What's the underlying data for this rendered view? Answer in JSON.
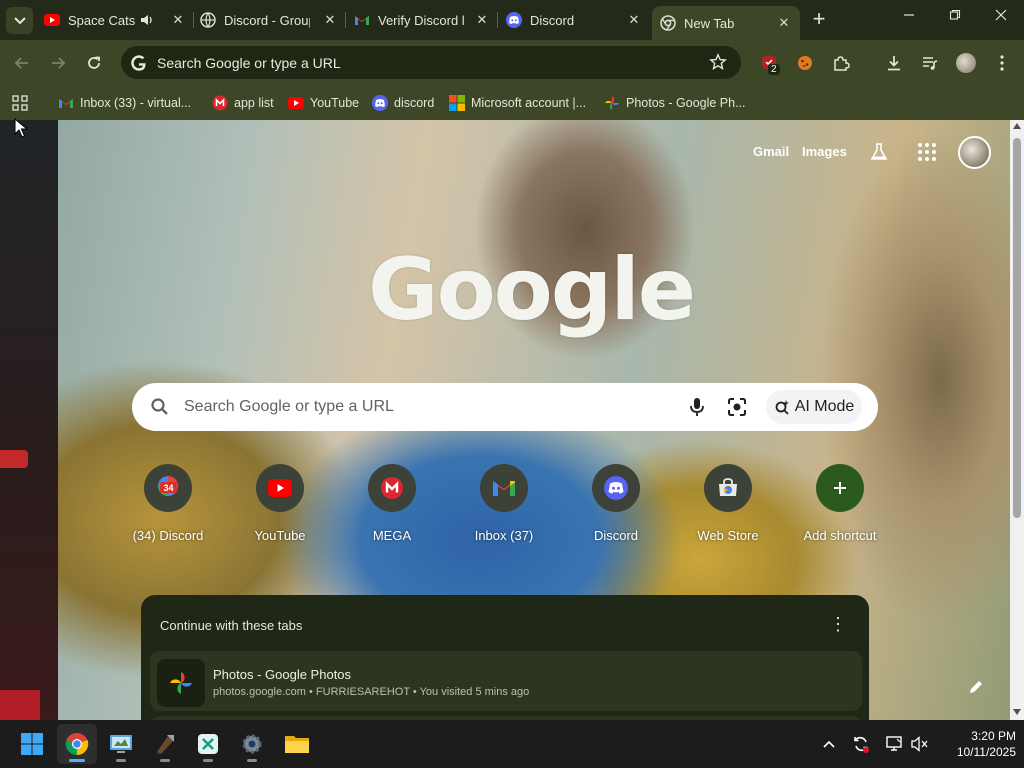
{
  "tabs": [
    {
      "title": "Space Cats",
      "icon": "youtube-icon",
      "audio": true
    },
    {
      "title": "Discord - Group",
      "icon": "globe-icon"
    },
    {
      "title": "Verify Discord l",
      "icon": "gmail-icon"
    },
    {
      "title": "Discord",
      "icon": "discord-icon"
    },
    {
      "title": "New Tab",
      "icon": "chrome-icon",
      "active": true
    }
  ],
  "omnibox": {
    "text": "Search Google or type a URL"
  },
  "extensions": {
    "badge_count": "2"
  },
  "bookmarks": [
    {
      "label": "Inbox (33) - virtual...",
      "icon": "gmail-icon"
    },
    {
      "label": "app list",
      "icon": "mega-icon"
    },
    {
      "label": "YouTube",
      "icon": "youtube-icon"
    },
    {
      "label": "discord",
      "icon": "discord-icon"
    },
    {
      "label": "Microsoft account |...",
      "icon": "microsoft-icon"
    },
    {
      "label": "Photos - Google Ph...",
      "icon": "google-photos-icon"
    }
  ],
  "ntp": {
    "gmail_link": "Gmail",
    "images_link": "Images",
    "logo_text": "Google",
    "search_placeholder": "Search Google or type a URL",
    "ai_mode_label": "AI Mode",
    "shortcuts": [
      {
        "label": "(34) Discord",
        "icon": "discord-badge-icon",
        "badge": "34"
      },
      {
        "label": "YouTube",
        "icon": "youtube-icon"
      },
      {
        "label": "MEGA",
        "icon": "mega-icon"
      },
      {
        "label": "Inbox (37)",
        "icon": "gmail-icon"
      },
      {
        "label": "Discord",
        "icon": "discord-icon"
      },
      {
        "label": "Web Store",
        "icon": "web-store-icon"
      },
      {
        "label": "Add shortcut",
        "icon": "plus-icon"
      }
    ],
    "continue_heading": "Continue with these tabs",
    "continue_items": [
      {
        "title": "Photos - Google Photos",
        "subtitle": "photos.google.com • FURRIESAREHOT • You visited 5 mins ago",
        "icon": "google-photos-icon"
      }
    ]
  },
  "taskbar": {
    "apps": [
      "windows-start-icon",
      "chrome-icon",
      "control-panel-icon",
      "minecraft-launcher-icon",
      "snipping-tool-icon",
      "settings-icon",
      "file-explorer-icon"
    ],
    "time": "3:20 PM",
    "date": "10/11/2025"
  },
  "colors": {
    "frame": "#3d4728",
    "tabbar": "#232a19",
    "omnibox": "#1f2614",
    "panel": "#1f2817"
  }
}
